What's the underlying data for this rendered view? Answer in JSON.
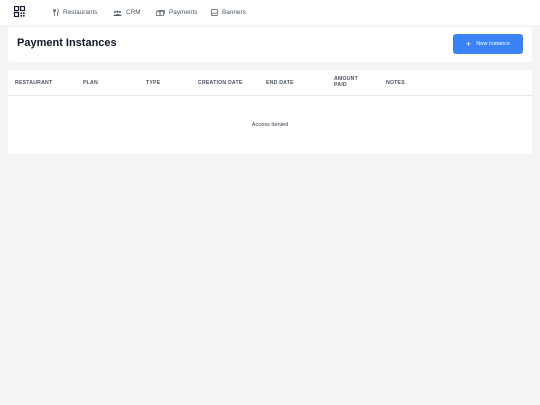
{
  "nav": {
    "logo_icon": "grid-logo-icon",
    "items": [
      {
        "label": "Restaurants",
        "icon": "fork-knife-icon"
      },
      {
        "label": "CRM",
        "icon": "users-icon"
      },
      {
        "label": "Payments",
        "icon": "cash-icon"
      },
      {
        "label": "Banners",
        "icon": "image-icon"
      }
    ]
  },
  "header": {
    "title": "Payment Instances",
    "new_button_label": "New Instance",
    "new_button_icon": "plus-icon"
  },
  "table": {
    "columns": [
      "RESTAURANT",
      "PLAN",
      "TYPE",
      "CREATION DATE",
      "END DATE",
      "AMOUNT\nPAID",
      "NOTES"
    ],
    "empty_message": "Access denied"
  },
  "colors": {
    "accent": "#3b82f6",
    "background": "#f4f4f4",
    "card": "#ffffff"
  }
}
